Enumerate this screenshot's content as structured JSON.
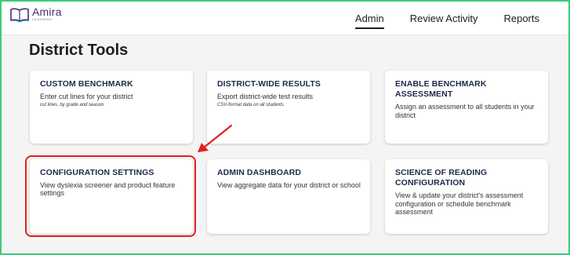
{
  "header": {
    "logo_word": "Amira",
    "logo_sub": "LEARNING",
    "nav": [
      {
        "label": "Admin",
        "active": true
      },
      {
        "label": "Review Activity",
        "active": false
      },
      {
        "label": "Reports",
        "active": false
      }
    ]
  },
  "page_title": "District Tools",
  "cards": [
    {
      "title": "CUSTOM BENCHMARK",
      "desc": "Enter cut lines for your district",
      "note": "cut lines, by grade and season"
    },
    {
      "title": "DISTRICT-WIDE RESULTS",
      "desc": "Export district-wide test results",
      "note": "CSV-format data on all students"
    },
    {
      "title": "ENABLE BENCHMARK ASSESSMENT",
      "desc": "Assign an assessment to all students in your district"
    },
    {
      "title": "CONFIGURATION SETTINGS",
      "desc": "View dyslexia screener and product feature settings"
    },
    {
      "title": "ADMIN DASHBOARD",
      "desc": "View aggregate data for your district or school"
    },
    {
      "title": "SCIENCE OF READING CONFIGURATION",
      "desc": "View & update your district's assessment configuration or schedule benchmark assessment"
    }
  ],
  "colors": {
    "frame_border": "#3ecb78",
    "highlight": "#e02020",
    "logo": "#4a2d73",
    "card_title": "#1e2a4a"
  }
}
